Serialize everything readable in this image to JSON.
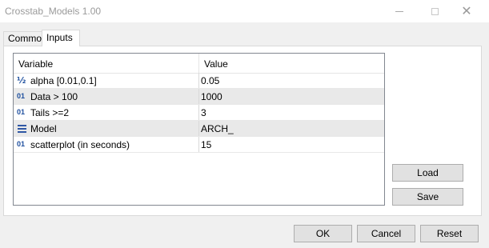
{
  "window": {
    "title": "Crosstab_Models 1.00"
  },
  "tabs": [
    {
      "label": "Common"
    },
    {
      "label": "Inputs"
    }
  ],
  "grid": {
    "headers": {
      "variable": "Variable",
      "value": "Value"
    },
    "rows": [
      {
        "icon": "fraction-icon",
        "icon_text": "½",
        "name": "alpha [0.01,0.1]",
        "value": "0.05"
      },
      {
        "icon": "integer-icon",
        "icon_text": "01",
        "name": "Data > 100",
        "value": "1000"
      },
      {
        "icon": "integer-icon",
        "icon_text": "01",
        "name": "Tails >=2",
        "value": "3"
      },
      {
        "icon": "enum-list-icon",
        "icon_text": "",
        "name": "Model",
        "value": "ARCH_"
      },
      {
        "icon": "integer-icon",
        "icon_text": "01",
        "name": "scatterplot (in seconds)",
        "value": "15"
      }
    ]
  },
  "side_buttons": {
    "load": "Load",
    "save": "Save"
  },
  "footer_buttons": {
    "ok": "OK",
    "cancel": "Cancel",
    "reset": "Reset"
  },
  "colors": {
    "icon_blue": "#1e4f9e",
    "alt_row": "#e9e9e9",
    "button_face": "#e1e1e1"
  }
}
